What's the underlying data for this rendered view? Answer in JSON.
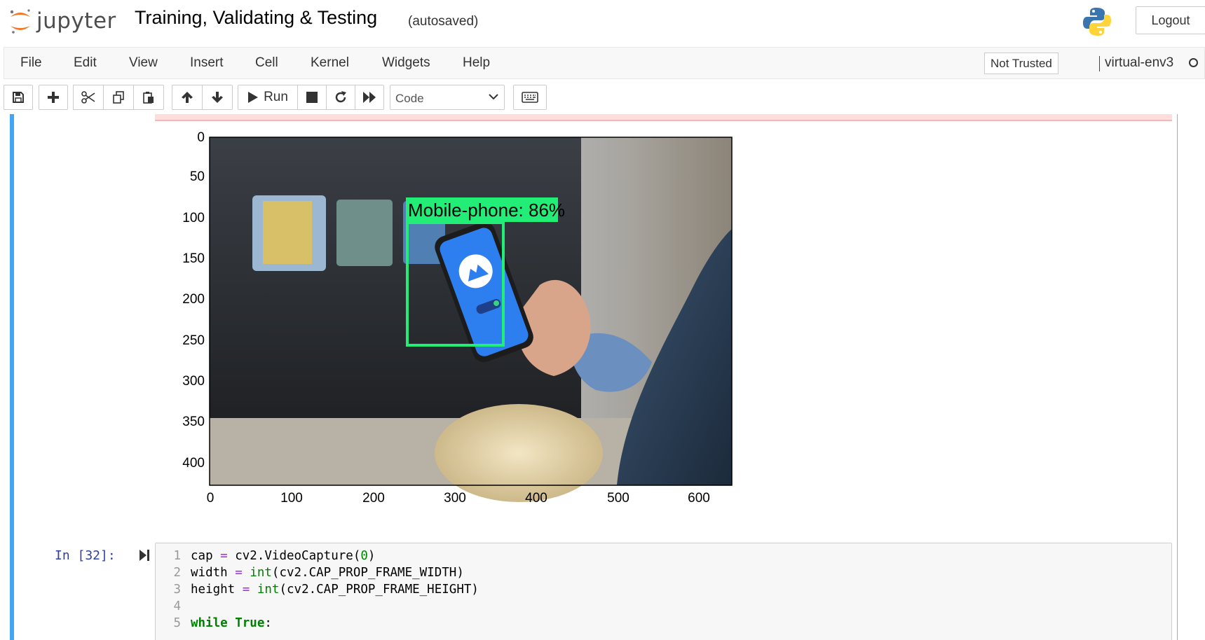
{
  "header": {
    "brand": "jupyter",
    "notebook_title": "Training, Validating & Testing",
    "autosave_status": "(autosaved)",
    "logout_label": "Logout"
  },
  "menubar": {
    "items": [
      "File",
      "Edit",
      "View",
      "Insert",
      "Cell",
      "Kernel",
      "Widgets",
      "Help"
    ],
    "trust_status": "Not Trusted",
    "kernel_name": "virtual-env3"
  },
  "toolbar": {
    "run_label": "Run",
    "cell_type": "Code",
    "icons": [
      "save-icon",
      "plus-icon",
      "scissors-icon",
      "copy-icon",
      "paste-icon",
      "arrow-up-icon",
      "arrow-down-icon",
      "play-icon",
      "stop-icon",
      "restart-icon",
      "fast-forward-icon",
      "keyboard-icon"
    ]
  },
  "output_plot": {
    "detection_label": "Mobile-phone: 86%",
    "box_color": "#22ee77",
    "y_ticks": [
      "0",
      "50",
      "100",
      "150",
      "200",
      "250",
      "300",
      "350",
      "400"
    ],
    "x_ticks": [
      "0",
      "100",
      "200",
      "300",
      "400",
      "500",
      "600"
    ]
  },
  "code_cell": {
    "prompt": "In [32]:",
    "lines": [
      {
        "n": "1",
        "text": "cap = cv2.VideoCapture(0)"
      },
      {
        "n": "2",
        "text": "width = int(cv2.CAP_PROP_FRAME_WIDTH)"
      },
      {
        "n": "3",
        "text": "height = int(cv2.CAP_PROP_FRAME_HEIGHT)"
      },
      {
        "n": "4",
        "text": ""
      },
      {
        "n": "5",
        "text": "while True:"
      }
    ]
  },
  "colors": {
    "selected_cell_accent": "#42a5f5",
    "prompt_color": "#303f9f",
    "logo_orange": "#f37726"
  }
}
